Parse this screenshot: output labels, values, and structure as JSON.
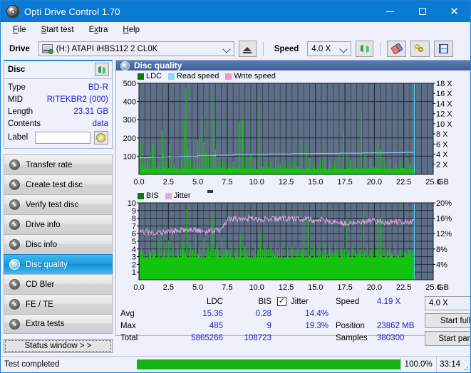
{
  "window": {
    "title": "Opti Drive Control 1.70",
    "icon": "disc-icon",
    "controls": {
      "minimize": "minimize-icon",
      "maximize": "maximize-icon",
      "close": "close-icon"
    }
  },
  "menubar": [
    {
      "label": "File",
      "accel": "F"
    },
    {
      "label": "Start test",
      "accel": "S"
    },
    {
      "label": "Extra",
      "accel": "x"
    },
    {
      "label": "Help",
      "accel": "H"
    }
  ],
  "toolbar": {
    "drive_label": "Drive",
    "drive_value": "(H:)  ATAPI iHBS112  2 CL0K",
    "eject_icon": "eject-icon",
    "speed_label": "Speed",
    "speed_value": "4.0 X",
    "refresh_icon": "refresh-icon",
    "erase_icon": "eraser-icon",
    "keys_icon": "keys-icon",
    "save_icon": "save-icon"
  },
  "disc": {
    "title": "Disc",
    "refresh_icon": "refresh-icon",
    "rows": [
      {
        "key": "Type",
        "value": "BD-R"
      },
      {
        "key": "MID",
        "value": "RITEKBR2 (000)"
      },
      {
        "key": "Length",
        "value": "23.31 GB"
      },
      {
        "key": "Contents",
        "value": "data"
      }
    ],
    "label_key": "Label",
    "label_value": "",
    "label_placeholder": "",
    "label_icon": "cd-icon"
  },
  "nav": {
    "items": [
      {
        "label": "Transfer rate",
        "icon": "disc-icon",
        "active": false
      },
      {
        "label": "Create test disc",
        "icon": "disc-icon",
        "active": false
      },
      {
        "label": "Verify test disc",
        "icon": "disc-icon",
        "active": false
      },
      {
        "label": "Drive info",
        "icon": "disc-icon",
        "active": false
      },
      {
        "label": "Disc info",
        "icon": "disc-icon",
        "active": false
      },
      {
        "label": "Disc quality",
        "icon": "disc-icon",
        "active": true
      },
      {
        "label": "CD Bler",
        "icon": "disc-icon",
        "active": false
      },
      {
        "label": "FE / TE",
        "icon": "disc-icon",
        "active": false
      },
      {
        "label": "Extra tests",
        "icon": "disc-icon",
        "active": false
      }
    ],
    "status_window": "Status window > >"
  },
  "panel": {
    "title": "Disc quality",
    "icon": "disc-icon"
  },
  "stats": {
    "col_headers": [
      "LDC",
      "BIS"
    ],
    "rows": [
      {
        "label": "Avg",
        "ldc": "15.36",
        "bis": "0.28"
      },
      {
        "label": "Max",
        "ldc": "485",
        "bis": "9"
      },
      {
        "label": "Total",
        "ldc": "5865266",
        "bis": "108723"
      }
    ],
    "jitter_label": "Jitter",
    "jitter_checked": true,
    "jitter_avg": "14.4%",
    "jitter_max": "19.3%",
    "speed_label": "Speed",
    "speed_value": "4.19 X",
    "position_label": "Position",
    "position_value": "23862 MB",
    "samples_label": "Samples",
    "samples_value": "380300",
    "speed_select": "4.0 X",
    "start_full": "Start full",
    "start_part": "Start part"
  },
  "statusbar": {
    "message": "Test completed",
    "percent": "100.0%",
    "percent_value": 100,
    "elapsed": "33:14"
  },
  "colors": {
    "accent": "#0a7ad4",
    "plot_bg": "#5d6e87",
    "grid": "#2a2f3a",
    "ldc_green": "#12c40e",
    "read_speed": "#8fd6f5",
    "write_speed": "#f48fe0",
    "jitter_pink": "#e0a8e0",
    "value_blue": "#2020c8",
    "progress_green": "#12b312"
  },
  "chart_data": [
    {
      "type": "area",
      "name": "top-chart-ldc",
      "title": "",
      "xlabel": "GB",
      "ylabel": "",
      "xlim": [
        0,
        25
      ],
      "ylim": [
        0,
        500
      ],
      "y2lim": [
        0,
        18
      ],
      "grid": true,
      "legend": [
        "LDC",
        "Read speed",
        "Write speed"
      ],
      "legend_position": "top-left",
      "xticks": [
        "0.0",
        "2.5",
        "5.0",
        "7.5",
        "10.0",
        "12.5",
        "15.0",
        "17.5",
        "20.0",
        "22.5",
        "25.0"
      ],
      "yticks": [
        "100",
        "200",
        "300",
        "400",
        "500"
      ],
      "y2ticks": [
        "2 X",
        "4 X",
        "6 X",
        "8 X",
        "10 X",
        "12 X",
        "14 X",
        "16 X",
        "18 X"
      ],
      "x_unit": "GB",
      "data_end_x": 23.4,
      "series": [
        {
          "name": "LDC",
          "color": "#12c40e",
          "kind": "spikes",
          "baseline": 30,
          "peaks": [
            [
              0.15,
              175
            ],
            [
              0.3,
              60
            ],
            [
              0.5,
              95
            ],
            [
              0.75,
              70
            ],
            [
              0.95,
              120
            ],
            [
              1.15,
              165
            ],
            [
              1.25,
              160
            ],
            [
              1.4,
              85
            ],
            [
              1.7,
              75
            ],
            [
              2.0,
              245
            ],
            [
              2.05,
              120
            ],
            [
              2.3,
              70
            ],
            [
              2.6,
              165
            ],
            [
              2.65,
              110
            ],
            [
              3.0,
              60
            ],
            [
              3.3,
              70
            ],
            [
              3.6,
              80
            ],
            [
              3.85,
              290
            ],
            [
              4.0,
              475
            ],
            [
              4.15,
              150
            ],
            [
              4.4,
              80
            ],
            [
              4.7,
              65
            ],
            [
              5.0,
              190
            ],
            [
              5.15,
              205
            ],
            [
              5.35,
              320
            ],
            [
              5.5,
              175
            ],
            [
              5.7,
              120
            ],
            [
              5.9,
              95
            ],
            [
              6.2,
              480
            ],
            [
              6.35,
              300
            ],
            [
              6.5,
              140
            ],
            [
              6.8,
              90
            ],
            [
              7.1,
              75
            ],
            [
              7.4,
              65
            ],
            [
              7.7,
              60
            ],
            [
              8.0,
              70
            ],
            [
              8.5,
              285
            ],
            [
              8.8,
              300
            ],
            [
              9.1,
              100
            ],
            [
              9.5,
              115
            ],
            [
              9.9,
              85
            ],
            [
              10.2,
              360
            ],
            [
              10.4,
              130
            ],
            [
              10.8,
              75
            ],
            [
              11.2,
              70
            ],
            [
              11.6,
              95
            ],
            [
              12.0,
              60
            ],
            [
              12.4,
              75
            ],
            [
              12.9,
              80
            ],
            [
              13.2,
              70
            ],
            [
              13.8,
              180
            ],
            [
              14.2,
              165
            ],
            [
              14.5,
              90
            ],
            [
              14.9,
              70
            ],
            [
              15.4,
              85
            ],
            [
              15.8,
              95
            ],
            [
              16.2,
              75
            ],
            [
              16.6,
              70
            ],
            [
              17.0,
              110
            ],
            [
              17.4,
              230
            ],
            [
              17.6,
              120
            ],
            [
              18.0,
              80
            ],
            [
              18.4,
              90
            ],
            [
              18.9,
              345
            ],
            [
              19.2,
              120
            ],
            [
              19.6,
              85
            ],
            [
              20.1,
              185
            ],
            [
              20.3,
              170
            ],
            [
              20.5,
              140
            ],
            [
              20.9,
              95
            ],
            [
              21.3,
              80
            ],
            [
              21.8,
              70
            ],
            [
              22.2,
              75
            ],
            [
              22.7,
              90
            ],
            [
              23.0,
              60
            ],
            [
              23.2,
              55
            ]
          ]
        },
        {
          "name": "Read speed",
          "color": "#8fd6f5",
          "kind": "step-line",
          "points": [
            [
              0,
              3.3
            ],
            [
              1.0,
              3.4
            ],
            [
              2.0,
              3.5
            ],
            [
              3.5,
              3.6
            ],
            [
              5.0,
              3.7
            ],
            [
              6.5,
              3.8
            ],
            [
              8.0,
              3.9
            ],
            [
              9.5,
              4.0
            ],
            [
              11.0,
              4.05
            ],
            [
              13.0,
              4.1
            ],
            [
              15.0,
              4.15
            ],
            [
              17.0,
              4.2
            ],
            [
              19.0,
              4.25
            ],
            [
              21.0,
              4.3
            ],
            [
              22.5,
              4.35
            ],
            [
              23.4,
              4.4
            ]
          ]
        },
        {
          "name": "Write speed",
          "color": "#f48fe0",
          "kind": "none",
          "points": []
        }
      ],
      "cursor_x": 23.4
    },
    {
      "type": "area",
      "name": "bottom-chart-bis",
      "title": "",
      "xlabel": "GB",
      "ylabel": "",
      "xlim": [
        0,
        25
      ],
      "ylim": [
        0,
        10
      ],
      "y2lim": [
        0,
        20
      ],
      "grid": true,
      "legend": [
        "BIS",
        "Jitter"
      ],
      "legend_position": "top-left",
      "xticks": [
        "0.0",
        "2.5",
        "5.0",
        "7.5",
        "10.0",
        "12.5",
        "15.0",
        "17.5",
        "20.0",
        "22.5",
        "25.0"
      ],
      "yticks": [
        "1",
        "2",
        "3",
        "4",
        "5",
        "6",
        "7",
        "8",
        "9",
        "10"
      ],
      "y2ticks": [
        "4%",
        "8%",
        "12%",
        "16%",
        "20%"
      ],
      "x_unit": "GB",
      "data_end_x": 23.4,
      "series": [
        {
          "name": "BIS",
          "color": "#12c40e",
          "kind": "spikes",
          "baseline": 2.9,
          "peaks": [
            [
              0.2,
              4.2
            ],
            [
              0.5,
              3.3
            ],
            [
              0.9,
              4.0
            ],
            [
              1.3,
              3.6
            ],
            [
              1.7,
              5.2
            ],
            [
              1.95,
              5.4
            ],
            [
              2.2,
              4.1
            ],
            [
              2.5,
              5.1
            ],
            [
              2.9,
              4.2
            ],
            [
              3.3,
              4.6
            ],
            [
              3.7,
              5.0
            ],
            [
              4.05,
              9.1
            ],
            [
              4.4,
              4.4
            ],
            [
              4.8,
              5.7
            ],
            [
              5.1,
              4.3
            ],
            [
              5.5,
              5.5
            ],
            [
              5.9,
              4.2
            ],
            [
              6.2,
              9.0
            ],
            [
              6.3,
              8.0
            ],
            [
              6.6,
              4.5
            ],
            [
              7.0,
              5.6
            ],
            [
              7.4,
              4.2
            ],
            [
              7.9,
              4.5
            ],
            [
              8.3,
              4.3
            ],
            [
              8.6,
              6.1
            ],
            [
              9.0,
              4.4
            ],
            [
              9.4,
              4.2
            ],
            [
              9.9,
              4.6
            ],
            [
              10.3,
              6.1
            ],
            [
              10.7,
              4.3
            ],
            [
              11.2,
              4.4
            ],
            [
              11.6,
              4.2
            ],
            [
              12.1,
              4.5
            ],
            [
              12.6,
              4.3
            ],
            [
              13.0,
              4.4
            ],
            [
              13.5,
              4.2
            ],
            [
              14.0,
              8.0
            ],
            [
              14.4,
              8.1
            ],
            [
              14.9,
              4.4
            ],
            [
              15.3,
              4.2
            ],
            [
              15.8,
              4.6
            ],
            [
              16.2,
              4.3
            ],
            [
              16.7,
              4.4
            ],
            [
              17.2,
              4.2
            ],
            [
              17.6,
              8.0
            ],
            [
              18.1,
              4.4
            ],
            [
              18.6,
              4.3
            ],
            [
              19.05,
              13.7
            ],
            [
              19.4,
              4.5
            ],
            [
              19.8,
              4.2
            ],
            [
              20.3,
              8.1
            ],
            [
              20.5,
              8.0
            ],
            [
              20.9,
              4.4
            ],
            [
              21.3,
              4.2
            ],
            [
              21.8,
              4.5
            ],
            [
              22.2,
              3.9
            ],
            [
              22.6,
              3.6
            ],
            [
              22.9,
              3.4
            ],
            [
              23.2,
              3.3
            ]
          ]
        },
        {
          "name": "Jitter",
          "color": "#e0a8e0",
          "kind": "noisy-line",
          "points": [
            [
              0,
              12.2
            ],
            [
              1,
              12.4
            ],
            [
              2,
              12.3
            ],
            [
              3,
              12.7
            ],
            [
              4,
              13.0
            ],
            [
              5,
              12.8
            ],
            [
              6,
              12.6
            ],
            [
              7,
              12.9
            ],
            [
              7.5,
              15.6
            ],
            [
              9,
              15.9
            ],
            [
              11,
              15.8
            ],
            [
              13,
              15.9
            ],
            [
              15,
              15.6
            ],
            [
              16.5,
              15.2
            ],
            [
              17.5,
              14.6
            ],
            [
              18.5,
              14.8
            ],
            [
              19.5,
              15.3
            ],
            [
              21,
              15.0
            ],
            [
              22.5,
              15.2
            ],
            [
              23.4,
              15.1
            ]
          ],
          "noise": 0.8
        }
      ],
      "cursor_x": 23.4
    }
  ]
}
